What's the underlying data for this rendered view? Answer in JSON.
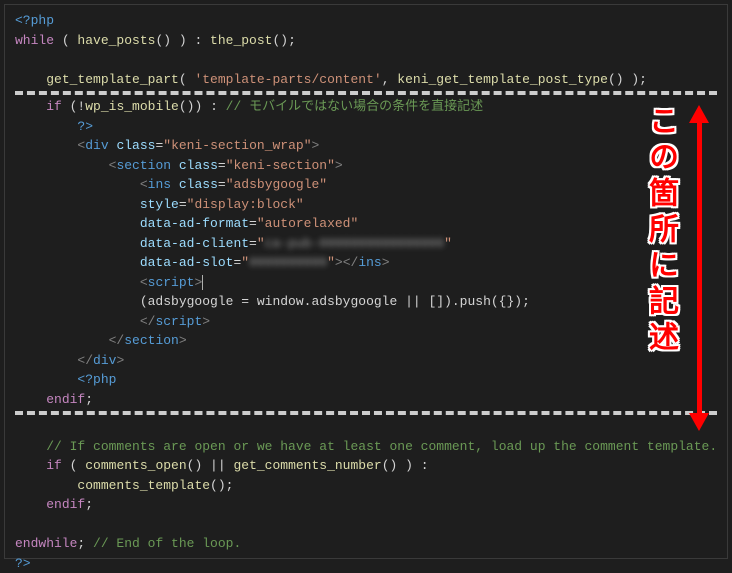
{
  "annotation": {
    "label": "この箇所に記述"
  },
  "code": {
    "l1_php_open": "<?php",
    "l2_while": "while",
    "l2_have_posts": "have_posts",
    "l2_the_post": "the_post",
    "l4_get_template_part": "get_template_part",
    "l4_str1": "'template-parts/content'",
    "l4_fn2": "keni_get_template_post_type",
    "l6_if": "if",
    "l6_wp_is_mobile": "wp_is_mobile",
    "l6_comment": "// モバイルではない場合の条件を直接記述",
    "l7_php_close": "?>",
    "l8_div": "div",
    "l8_class": "class",
    "l8_classval": "\"keni-section_wrap\"",
    "l9_section": "section",
    "l9_classval": "\"keni-section\"",
    "l10_ins": "ins",
    "l10_classval": "\"adsbygoogle\"",
    "l11_style": "style",
    "l11_styleval": "\"display:block\"",
    "l12_dataformat": "data-ad-format",
    "l12_formatval": "\"autorelaxed\"",
    "l13_dataclient": "data-ad-client",
    "l13_clientval": "\"ca-pub-1234567890123456\"",
    "l14_dataslot": "data-ad-slot",
    "l14_slotval": "\"1234567890\"",
    "l15_script": "script",
    "l16_adsbygoogle": "(adsbygoogle = window.adsbygoogle || []).push({});",
    "l19_php_open": "<?php",
    "l20_endif": "endif",
    "l22_comment": "// If comments are open or we have at least one comment, load up the comment template.",
    "l23_if": "if",
    "l23_comments_open": "comments_open",
    "l23_get_comments_number": "get_comments_number",
    "l24_comments_template": "comments_template",
    "l25_endif": "endif",
    "l27_endwhile": "endwhile",
    "l27_comment": "// End of the loop.",
    "l28_php_close": "?>"
  }
}
